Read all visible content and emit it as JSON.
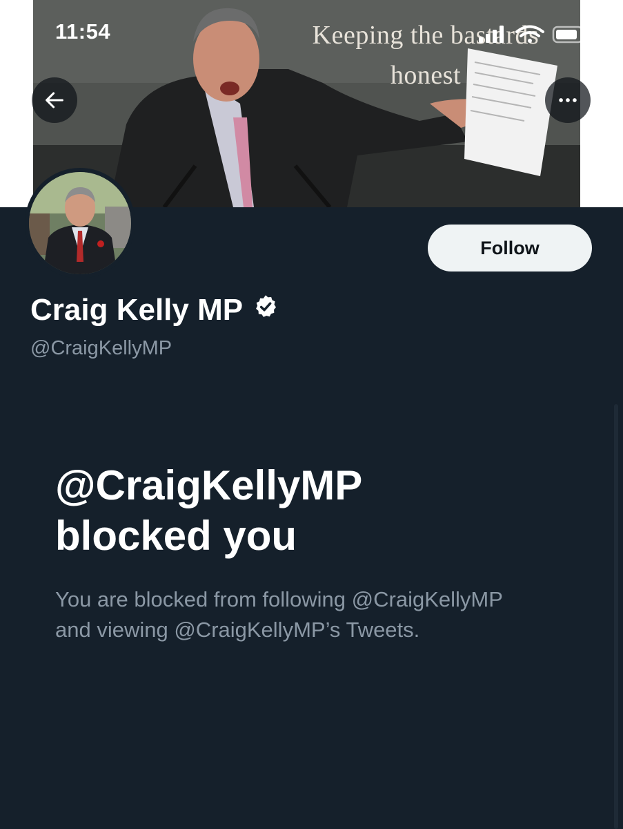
{
  "status_bar": {
    "time": "11:54"
  },
  "banner": {
    "caption_line1": "Keeping the bastards",
    "caption_line2": "honest"
  },
  "nav": {
    "back_icon": "arrow-left-icon",
    "more_icon": "more-horizontal-icon"
  },
  "profile": {
    "display_name": "Craig Kelly MP",
    "handle": "@CraigKellyMP",
    "verified": true,
    "follow_label": "Follow"
  },
  "blocked": {
    "title_line1": "@CraigKellyMP",
    "title_line2": "blocked you",
    "description_line1": "You are blocked from following @CraigKellyMP",
    "description_line2": "and viewing @CraigKellyMP’s Tweets."
  },
  "colors": {
    "background": "#15202b",
    "text_primary": "#ffffff",
    "text_secondary": "#8b98a5",
    "follow_button_bg": "#eff3f4",
    "follow_button_text": "#0f1419"
  }
}
